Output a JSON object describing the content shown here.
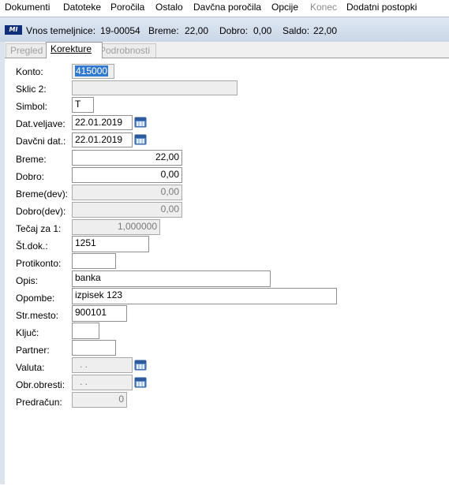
{
  "menu": [
    {
      "label": "Dokumenti",
      "disabled": false
    },
    {
      "label": "Datoteke",
      "disabled": false
    },
    {
      "label": "Poročila",
      "disabled": false
    },
    {
      "label": "Ostalo",
      "disabled": false
    },
    {
      "label": "Davčna poročila",
      "disabled": false
    },
    {
      "label": "Opcije",
      "disabled": false
    },
    {
      "label": "Konec",
      "disabled": true
    },
    {
      "label": "Dodatni postopki",
      "disabled": false
    }
  ],
  "header": {
    "logo_text": "MI",
    "title_label": "Vnos temeljnice:",
    "title_value": "19-00054",
    "breme_label": "Breme:",
    "breme_value": "22,00",
    "dobro_label": "Dobro:",
    "dobro_value": "0,00",
    "saldo_label": "Saldo:",
    "saldo_value": "22,00"
  },
  "tabs": [
    {
      "label": "Pregled",
      "active": false
    },
    {
      "label": "Korekture",
      "active": true
    },
    {
      "label": "Podrobnosti",
      "active": false
    }
  ],
  "form": {
    "konto": {
      "label": "Konto:",
      "value": "415000"
    },
    "sklic2": {
      "label": "Sklic 2:",
      "value": ""
    },
    "simbol": {
      "label": "Simbol:",
      "value": "T"
    },
    "dat_veljave": {
      "label": "Dat.veljave:",
      "value": "22.01.2019"
    },
    "davcni_dat": {
      "label": "Davčni dat.:",
      "value": "22.01.2019"
    },
    "breme": {
      "label": "Breme:",
      "value": "22,00"
    },
    "dobro": {
      "label": "Dobro:",
      "value": "0,00"
    },
    "breme_dev": {
      "label": "Breme(dev):",
      "value": "0,00"
    },
    "dobro_dev": {
      "label": "Dobro(dev):",
      "value": "0,00"
    },
    "tecaj": {
      "label": "Tečaj za 1:",
      "value": "1,000000"
    },
    "st_dok": {
      "label": "Št.dok.:",
      "value": "1251"
    },
    "protikonto": {
      "label": "Protikonto:",
      "value": ""
    },
    "opis": {
      "label": "Opis:",
      "value": "banka"
    },
    "opombe": {
      "label": "Opombe:",
      "value": "izpisek 123"
    },
    "str_mesto": {
      "label": "Str.mesto:",
      "value": "900101"
    },
    "kljuc": {
      "label": "Ključ:",
      "value": ""
    },
    "partner": {
      "label": "Partner:",
      "value": ""
    },
    "valuta": {
      "label": "Valuta:",
      "value": ". ."
    },
    "obr_obresti": {
      "label": "Obr.obresti:",
      "value": ". ."
    },
    "predracun": {
      "label": "Predračun:",
      "value": "0"
    }
  },
  "colors": {
    "selection": "#3078d0",
    "header_bg": "#d3deec",
    "logo_bg": "#0f2f7a"
  },
  "icons": {
    "date_picker": "calendar-icon"
  }
}
